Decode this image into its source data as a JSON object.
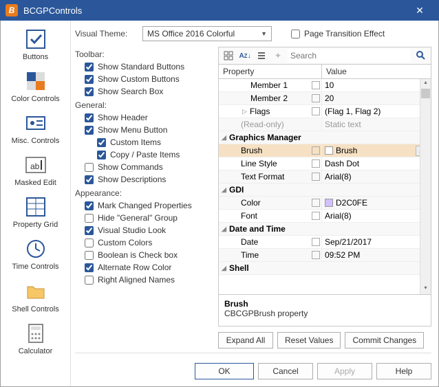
{
  "window": {
    "title": "BCGPControls",
    "icon_letter": "B"
  },
  "sidebar": {
    "items": [
      {
        "label": "Buttons",
        "icon": "check"
      },
      {
        "label": "Color Controls",
        "icon": "palette"
      },
      {
        "label": "Misc. Controls",
        "icon": "id"
      },
      {
        "label": "Masked Edit",
        "icon": "ab"
      },
      {
        "label": "Property Grid",
        "icon": "grid",
        "selected": true
      },
      {
        "label": "Time Controls",
        "icon": "clock"
      },
      {
        "label": "Shell Controls",
        "icon": "folder"
      },
      {
        "label": "Calculator",
        "icon": "calc"
      }
    ]
  },
  "theme": {
    "label": "Visual Theme:",
    "value": "MS Office 2016 Colorful",
    "page_transition_label": "Page Transition Effect",
    "page_transition_checked": false
  },
  "options": {
    "toolbar_head": "Toolbar:",
    "show_standard": {
      "label": "Show Standard Buttons",
      "checked": true
    },
    "show_custom": {
      "label": "Show Custom Buttons",
      "checked": true
    },
    "show_search": {
      "label": "Show Search Box",
      "checked": true
    },
    "general_head": "General:",
    "show_header": {
      "label": "Show Header",
      "checked": true
    },
    "show_menu": {
      "label": "Show Menu Button",
      "checked": true
    },
    "custom_items": {
      "label": "Custom Items",
      "checked": true
    },
    "copy_paste": {
      "label": "Copy / Paste Items",
      "checked": true
    },
    "show_commands": {
      "label": "Show Commands",
      "checked": false
    },
    "show_desc": {
      "label": "Show Descriptions",
      "checked": true
    },
    "appearance_head": "Appearance:",
    "mark_changed": {
      "label": "Mark Changed Properties",
      "checked": true
    },
    "hide_general": {
      "label": "Hide \"General\" Group",
      "checked": false
    },
    "vs_look": {
      "label": "Visual Studio Look",
      "checked": true
    },
    "custom_colors": {
      "label": "Custom Colors",
      "checked": false
    },
    "bool_checkbox": {
      "label": "Boolean is Check box",
      "checked": false
    },
    "alt_row": {
      "label": "Alternate Row Color",
      "checked": true
    },
    "right_aligned": {
      "label": "Right Aligned Names",
      "checked": false
    }
  },
  "grid": {
    "search_placeholder": "Search",
    "header": {
      "property": "Property",
      "value": "Value"
    },
    "rows": [
      {
        "indent": 2,
        "name": "Member 1",
        "value": "10",
        "editsq": true
      },
      {
        "indent": 2,
        "name": "Member 2",
        "value": "20",
        "editsq": true,
        "alt": true
      },
      {
        "indent": 1,
        "expander": "▹",
        "name": "Flags",
        "value": "(Flag 1, Flag 2)",
        "editsq": true
      },
      {
        "indent": 1,
        "name": "(Read-only)",
        "value": "Static text",
        "readonly": true,
        "alt": true
      },
      {
        "cat": true,
        "expander": "◿",
        "name": "Graphics Manager"
      },
      {
        "indent": 1,
        "name": "Brush",
        "value": "Brush",
        "color": "#ffffff",
        "editsq": true,
        "dots": true,
        "selected": true
      },
      {
        "indent": 1,
        "name": "Line Style",
        "value": "Dash Dot",
        "editsq": true
      },
      {
        "indent": 1,
        "name": "Text Format",
        "value": "Arial(8)",
        "editsq": true,
        "alt": true
      },
      {
        "cat": true,
        "expander": "◿",
        "name": "GDI"
      },
      {
        "indent": 1,
        "name": "Color",
        "value": "D2C0FE",
        "color": "#d2c0fe",
        "editsq": true,
        "alt": true
      },
      {
        "indent": 1,
        "name": "Font",
        "value": "Arial(8)",
        "editsq": true
      },
      {
        "cat": true,
        "expander": "◿",
        "name": "Date and Time",
        "alt": true
      },
      {
        "indent": 1,
        "name": "Date",
        "value": "Sep/21/2017",
        "editsq": true
      },
      {
        "indent": 1,
        "name": "Time",
        "value": "09:52 PM",
        "editsq": true,
        "alt": true
      },
      {
        "cat": true,
        "expander": "◿",
        "name": "Shell"
      }
    ],
    "desc": {
      "title": "Brush",
      "text": "CBCGPBrush property"
    },
    "buttons": {
      "expand": "Expand All",
      "reset": "Reset Values",
      "commit": "Commit Changes"
    }
  },
  "dialog_buttons": {
    "ok": "OK",
    "cancel": "Cancel",
    "apply": "Apply",
    "help": "Help"
  }
}
